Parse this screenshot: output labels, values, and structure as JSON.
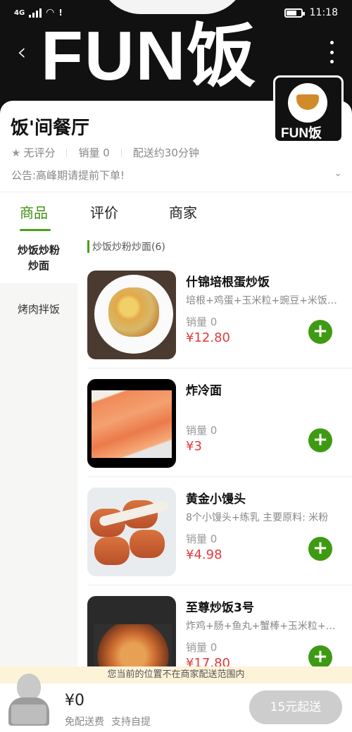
{
  "status_bar": {
    "network": "4G",
    "time": "11:18"
  },
  "banner": {
    "logo_text": "FUN饭"
  },
  "store": {
    "name": "饭'间餐厅",
    "logo_text": "FUN饭",
    "rating": "无评分",
    "sales": "销量 0",
    "delivery_time": "配送约30分钟",
    "notice": "公告:高峰期请提前下单!"
  },
  "tabs": [
    {
      "label": "商品",
      "active": true
    },
    {
      "label": "评价",
      "active": false
    },
    {
      "label": "商家",
      "active": false
    }
  ],
  "categories": [
    {
      "label": "炒饭炒粉炒面",
      "active": true
    },
    {
      "label": "烤肉拌饭",
      "active": false
    }
  ],
  "section_title": "炒饭炒粉炒面(6)",
  "products": [
    {
      "name": "什锦培根蛋炒饭",
      "desc": "培根+鸡蛋+玉米粒+豌豆+米饭…",
      "sales": "销量 0",
      "price": "¥12.80"
    },
    {
      "name": "炸冷面",
      "desc": "",
      "sales": "销量 0",
      "price": "¥3"
    },
    {
      "name": "黄金小馒头",
      "desc": "8个小馒头+练乳 主要原料: 米粉",
      "sales": "销量 0",
      "price": "¥4.98"
    },
    {
      "name": "至尊炒饭3号",
      "desc": "炸鸡+肠+鱼丸+蟹棒+玉米粒+…",
      "sales": "销量 0",
      "price": "¥17.80"
    }
  ],
  "out_of_range_notice": "您当前的位置不在商家配送范围内",
  "cart": {
    "total": "¥0",
    "free_delivery": "免配送费",
    "self_pickup": "支持自提",
    "checkout_label": "15元起送"
  },
  "colors": {
    "accent": "#4aa01a",
    "price": "#e03b3b",
    "notice_bg": "#fdf3d9"
  }
}
